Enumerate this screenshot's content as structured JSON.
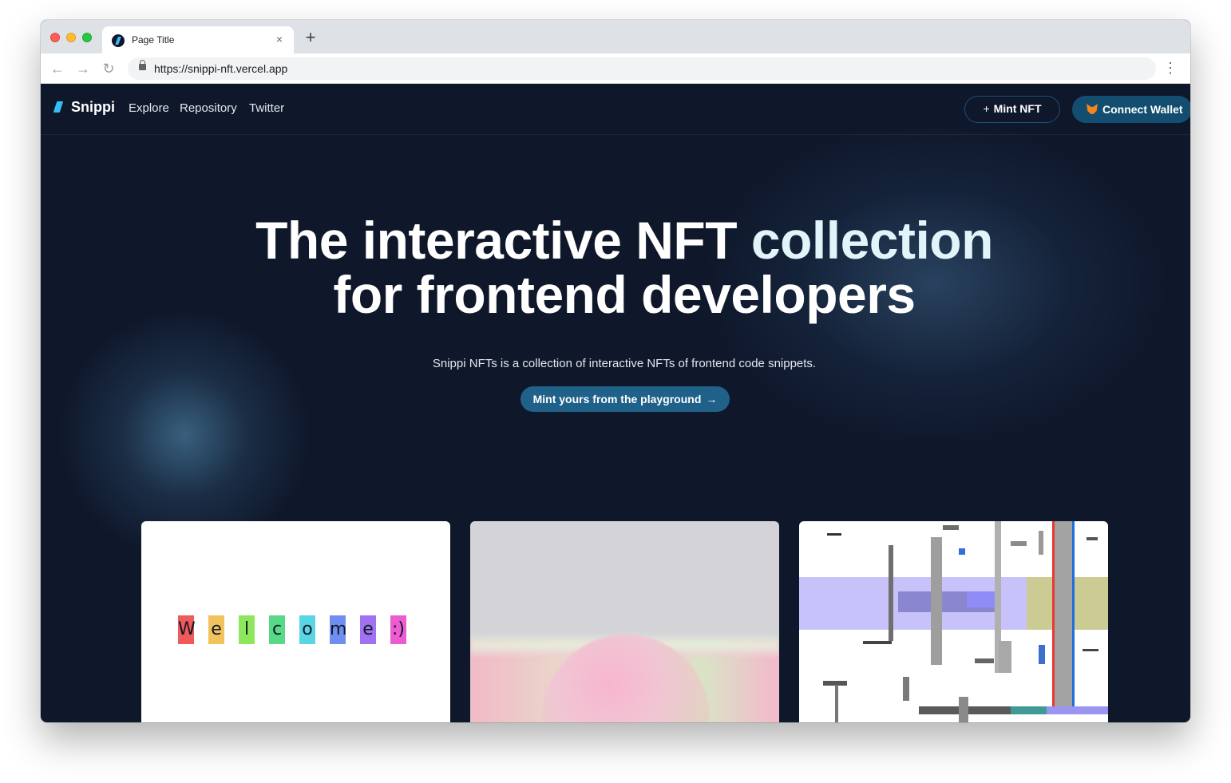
{
  "browser": {
    "tab_title": "Page Title",
    "tab_close": "×",
    "new_tab": "+",
    "url": "https://snippi-nft.vercel.app",
    "back": "←",
    "forward": "→",
    "reload": "↻",
    "menu": "⋮"
  },
  "navbar": {
    "brand": "Snippi",
    "links": [
      "Explore",
      "Repository",
      "Twitter"
    ],
    "mint_button": "Mint NFT",
    "mint_plus": "+",
    "wallet_button": "Connect Wallet"
  },
  "hero": {
    "title_part1": "The interactive NFT ",
    "title_accent": "collection",
    "title_line2": "for frontend developers",
    "subtitle": "Snippi NFTs is a collection of interactive NFTs of frontend code snippets.",
    "cta": "Mint yours from the playground",
    "cta_arrow": "→"
  },
  "cards": {
    "welcome_letters": [
      {
        "char": "W",
        "color": "#ef5a5a"
      },
      {
        "char": "e",
        "color": "#f2c35d"
      },
      {
        "char": "l",
        "color": "#8ee65c"
      },
      {
        "char": "c",
        "color": "#57d987"
      },
      {
        "char": "o",
        "color": "#5ad5e3"
      },
      {
        "char": "m",
        "color": "#6f8ff0"
      },
      {
        "char": "e",
        "color": "#a071f0"
      },
      {
        "char": ":)",
        "color": "#ec5cd0"
      }
    ]
  },
  "colors": {
    "page_bg": "#0f172a",
    "accent": "#38bdf8",
    "cta_bg": "#20618a",
    "wallet_bg": "#134e70"
  }
}
